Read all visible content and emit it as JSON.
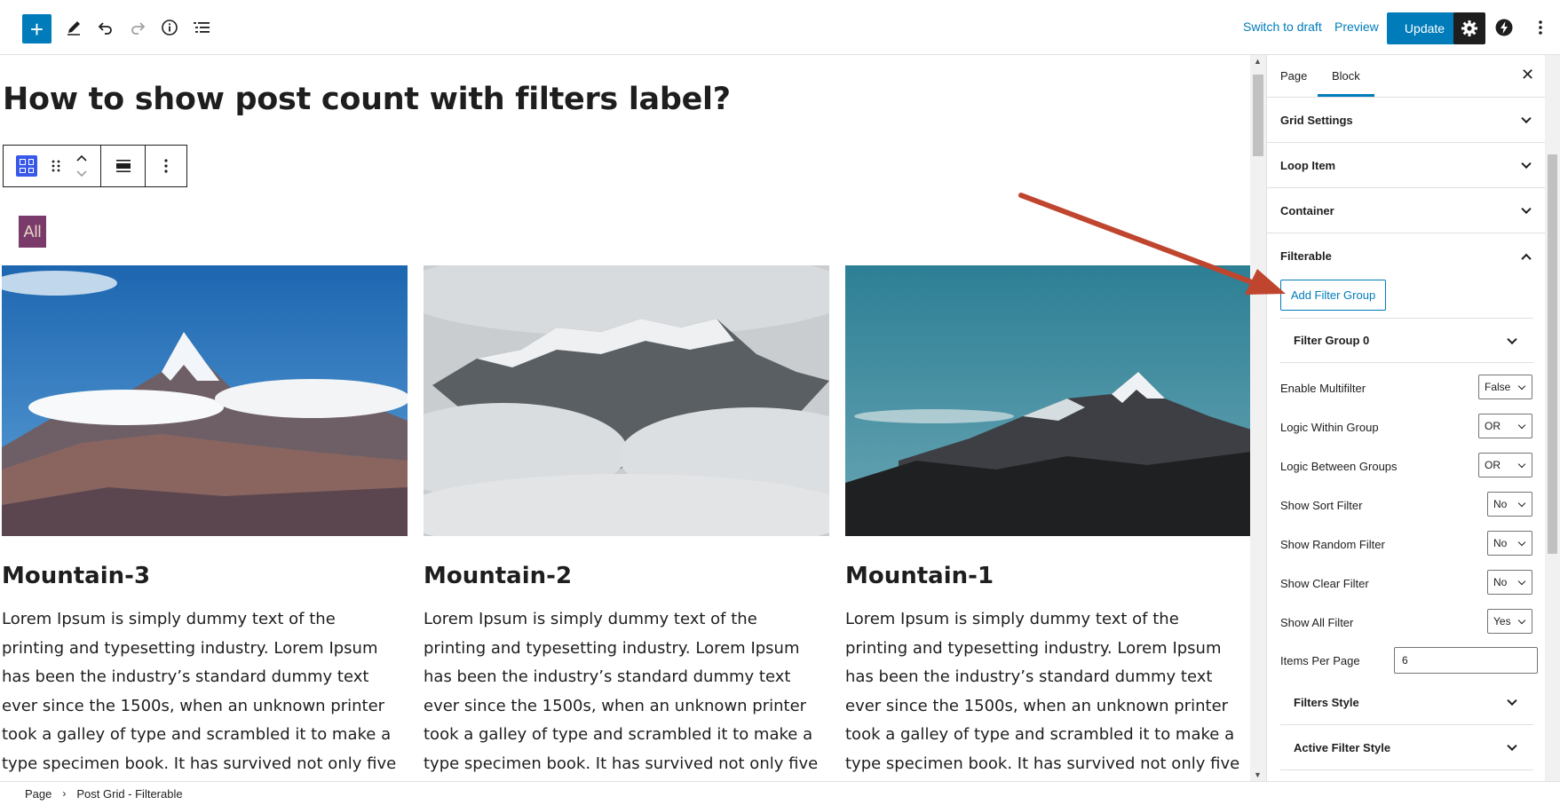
{
  "toolbar": {
    "add_icon": "plus-icon",
    "switch_to_draft": "Switch to draft",
    "preview": "Preview",
    "update": "Update"
  },
  "post": {
    "title": "How to show post count with filters label?",
    "filter_all": "All",
    "cards": [
      {
        "title": "Mountain-3",
        "excerpt": "Lorem Ipsum is simply dummy text of the printing and typesetting industry. Lorem Ipsum has been the industry’s standard dummy text ever since the 1500s, when an unknown printer took a galley of type and scrambled it to make a type specimen book. It has survived not only five centuries, but also the leap into"
      },
      {
        "title": "Mountain-2",
        "excerpt": "Lorem Ipsum is simply dummy text of the printing and typesetting industry. Lorem Ipsum has been the industry’s standard dummy text ever since the 1500s, when an unknown printer took a galley of type and scrambled it to make a type specimen book. It has survived not only five centuries, but also the leap into"
      },
      {
        "title": "Mountain-1",
        "excerpt": "Lorem Ipsum is simply dummy text of the printing and typesetting industry. Lorem Ipsum has been the industry’s standard dummy text ever since the 1500s, when an unknown printer took a galley of type and scrambled it to make a type specimen book. It has survived not only five centuries, but also the leap into"
      }
    ]
  },
  "sidebar": {
    "tabs": [
      "Page",
      "Block"
    ],
    "active_tab": "Block",
    "panels": {
      "grid_settings": "Grid Settings",
      "loop_item": "Loop Item",
      "container": "Container",
      "filterable": "Filterable"
    },
    "add_filter_group": "Add Filter Group",
    "filter_group": "Filter Group 0",
    "fields": {
      "enable_multifilter": {
        "label": "Enable Multifilter",
        "value": "False"
      },
      "logic_within_group": {
        "label": "Logic Within Group",
        "value": "OR"
      },
      "logic_between_groups": {
        "label": "Logic Between Groups",
        "value": "OR"
      },
      "show_sort_filter": {
        "label": "Show Sort Filter",
        "value": "No"
      },
      "show_random_filter": {
        "label": "Show Random Filter",
        "value": "No"
      },
      "show_clear_filter": {
        "label": "Show Clear Filter",
        "value": "No"
      },
      "show_all_filter": {
        "label": "Show All Filter",
        "value": "Yes"
      },
      "items_per_page": {
        "label": "Items Per Page",
        "value": "6"
      }
    },
    "filters_style": "Filters Style",
    "active_filter_style": "Active Filter Style"
  },
  "breadcrumb": {
    "items": [
      "Page",
      "Post Grid - Filterable"
    ]
  },
  "colors": {
    "accent": "#007cba",
    "filter_all_bg": "#7a3b6a",
    "annotation_arrow": "#c0452e"
  }
}
